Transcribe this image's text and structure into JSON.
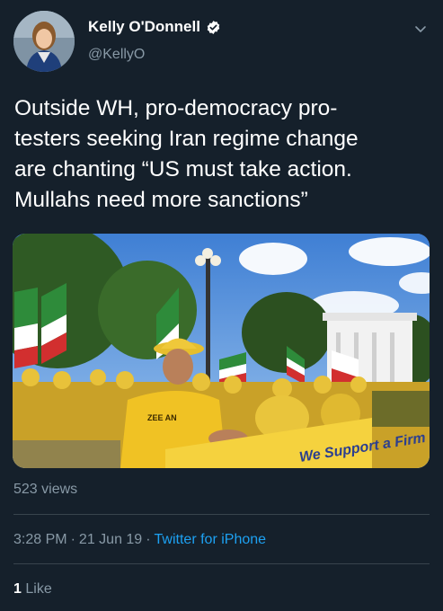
{
  "author": {
    "name": "Kelly O'Donnell",
    "handle": "@KellyO",
    "verified": true
  },
  "tweet": {
    "text_lines": [
      "Outside WH, pro-democracy pro-",
      "testers seeking Iran regime change",
      "are chanting “US must take action.",
      "Mullahs need more sanctions”"
    ]
  },
  "media": {
    "type": "video",
    "banner_text": "We Support a Firm Policy",
    "shirt_text": "ZEE AN"
  },
  "stats": {
    "views": "523 views",
    "time": "3:28 PM",
    "date": "21 Jun 19",
    "separator": "·",
    "source": "Twitter for iPhone",
    "like_count": "1",
    "like_label": "Like"
  },
  "colors": {
    "background": "#15202b",
    "secondary_text": "#8899a6",
    "link": "#1da1f2",
    "divider": "#38444d"
  }
}
